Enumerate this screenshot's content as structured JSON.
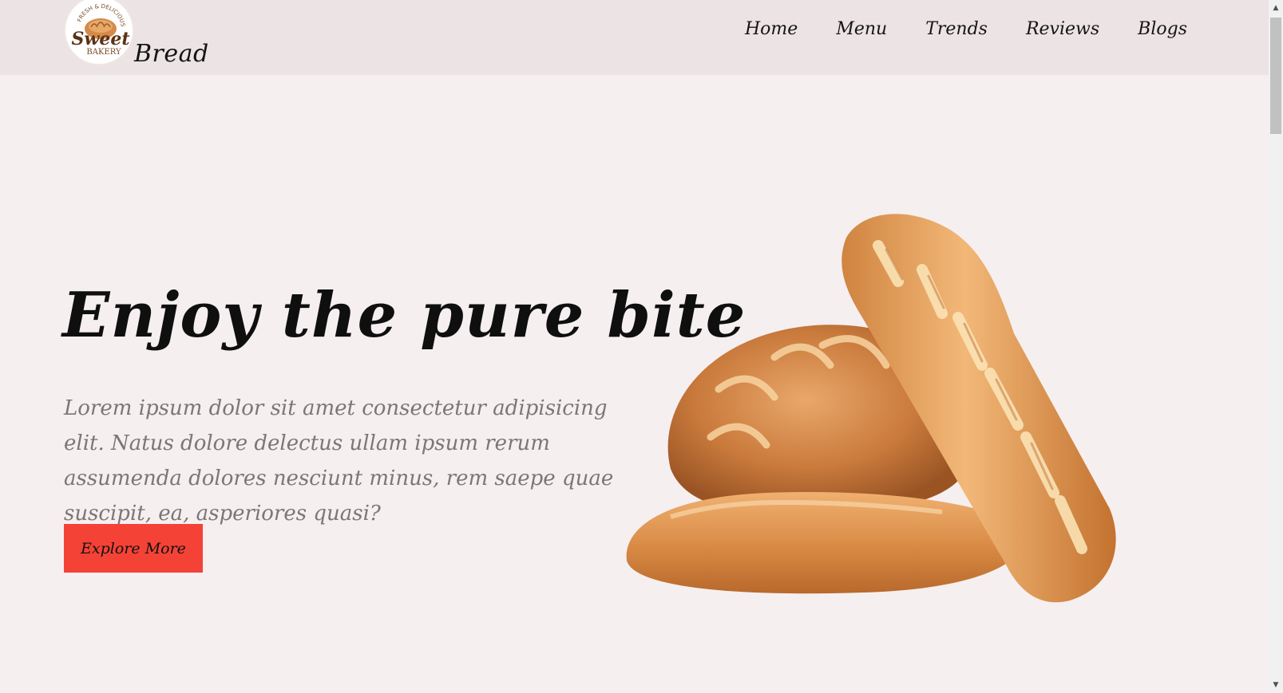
{
  "header": {
    "logo": {
      "icon": "sweet-bakery-logo-icon",
      "arc_text": "FRESH & DELICIOUS",
      "script_text": "Sweet",
      "sub_text": "BAKERY"
    },
    "brand": "Bread",
    "nav": [
      {
        "label": "Home"
      },
      {
        "label": "Menu"
      },
      {
        "label": "Trends"
      },
      {
        "label": "Reviews"
      },
      {
        "label": "Blogs"
      }
    ]
  },
  "hero": {
    "title": "Enjoy the pure bite",
    "description": "Lorem ipsum dolor sit amet consectetur adipisicing elit. Natus dolore delectus ullam ipsum rerum assumenda dolores nesciunt minus, rem saepe quae suscipit, ea, asperiores quasi?",
    "cta_label": "Explore More",
    "image": "bread-loaves-image"
  },
  "colors": {
    "header_bg": "#ece3e4",
    "page_bg": "#f6eff0",
    "cta_bg": "#f44336",
    "description_text": "#7b7677"
  }
}
